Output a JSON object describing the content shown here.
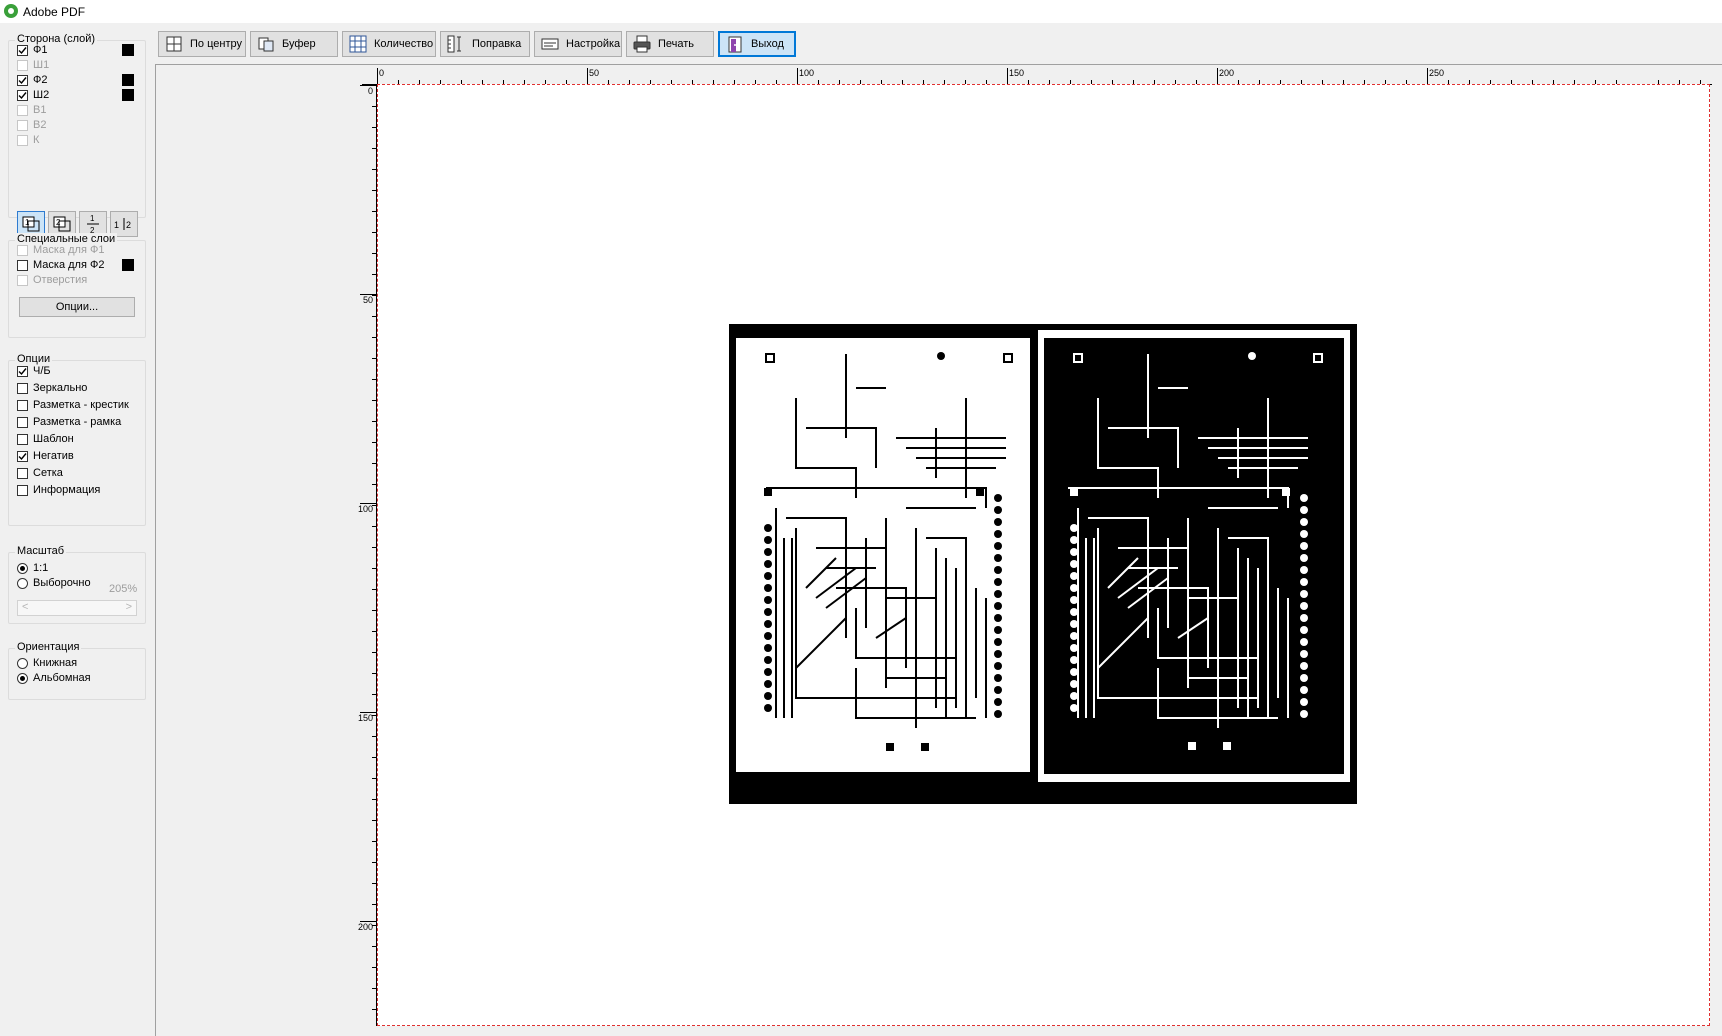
{
  "window": {
    "title": "Adobe PDF"
  },
  "side_group": {
    "title": "Сторона (слой)",
    "layers": [
      {
        "label": "Ф1",
        "checked": true,
        "enabled": true,
        "swatch": true
      },
      {
        "label": "Ш1",
        "checked": false,
        "enabled": false,
        "swatch": false
      },
      {
        "label": "Ф2",
        "checked": true,
        "enabled": true,
        "swatch": true
      },
      {
        "label": "Ш2",
        "checked": true,
        "enabled": true,
        "swatch": true
      },
      {
        "label": "В1",
        "checked": false,
        "enabled": false,
        "swatch": false
      },
      {
        "label": "В2",
        "checked": false,
        "enabled": false,
        "swatch": false
      },
      {
        "label": "К",
        "checked": false,
        "enabled": false,
        "swatch": false
      }
    ],
    "view_buttons": [
      "1",
      "2",
      "1/2",
      "1|2"
    ]
  },
  "special_group": {
    "title": "Специальные слои",
    "items": [
      {
        "label": "Маска для Ф1",
        "checked": false,
        "enabled": false,
        "swatch": false
      },
      {
        "label": "Маска для Ф2",
        "checked": false,
        "enabled": true,
        "swatch": true
      },
      {
        "label": "Отверстия",
        "checked": false,
        "enabled": false,
        "swatch": false
      }
    ],
    "options_button": "Опции..."
  },
  "options_group": {
    "title": "Опции",
    "items": [
      {
        "label": "Ч/Б",
        "checked": true
      },
      {
        "label": "Зеркально",
        "checked": false
      },
      {
        "label": "Разметка - крестик",
        "checked": false
      },
      {
        "label": "Разметка - рамка",
        "checked": false
      },
      {
        "label": "Шаблон",
        "checked": false
      },
      {
        "label": "Негатив",
        "checked": true
      },
      {
        "label": "Сетка",
        "checked": false
      },
      {
        "label": "Информация",
        "checked": false
      }
    ]
  },
  "scale_group": {
    "title": "Масштаб",
    "options": [
      {
        "label": "1:1",
        "selected": true
      },
      {
        "label": "Выборочно",
        "selected": false
      }
    ],
    "custom_percent": "205%",
    "slider_left": "<",
    "slider_right": ">"
  },
  "orientation_group": {
    "title": "Ориентация",
    "options": [
      {
        "label": "Книжная",
        "selected": false
      },
      {
        "label": "Альбомная",
        "selected": true
      }
    ]
  },
  "toolbar": {
    "buttons": [
      {
        "label": "По центру",
        "icon": "center-icon"
      },
      {
        "label": "Буфер",
        "icon": "clipboard-icon"
      },
      {
        "label": "Количество",
        "icon": "grid-count-icon"
      },
      {
        "label": "Поправка",
        "icon": "correction-icon"
      },
      {
        "label": "Настройка",
        "icon": "settings-icon"
      },
      {
        "label": "Печать",
        "icon": "printer-icon"
      },
      {
        "label": "Выход",
        "icon": "exit-icon"
      }
    ]
  },
  "ruler": {
    "horizontal_labels": [
      "0",
      "50",
      "100",
      "150",
      "200",
      "250"
    ],
    "vertical_labels": [
      "0",
      "50",
      "100",
      "150",
      "200"
    ]
  },
  "colors": {
    "accent": "#0078d7",
    "page_border": "#e03030"
  }
}
